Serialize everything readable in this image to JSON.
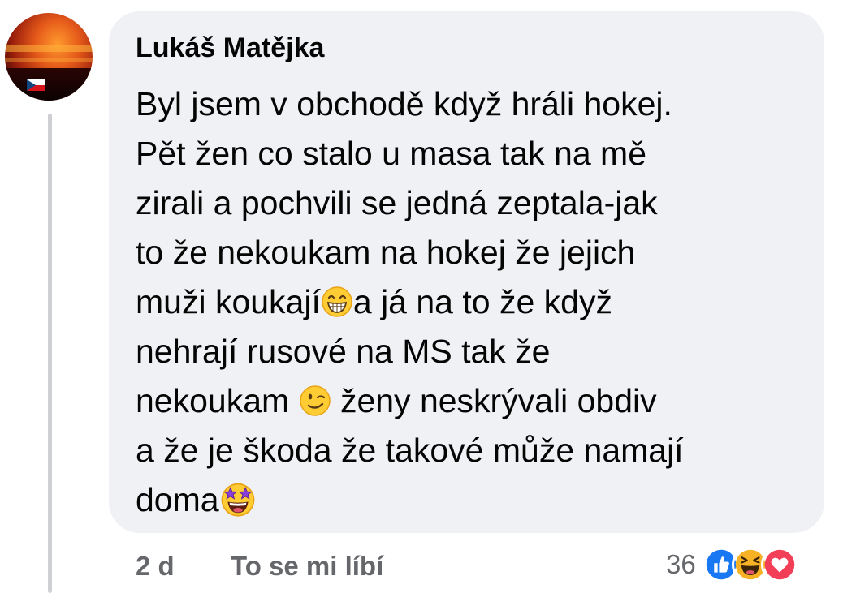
{
  "comment": {
    "author": "Lukáš Matějka",
    "lines": [
      {
        "before": "Byl jsem v obchodě když hráli hokej.",
        "emoji": "",
        "after": ""
      },
      {
        "before": "Pět žen co stalo u masa tak na mě",
        "emoji": "",
        "after": ""
      },
      {
        "before": "zirali  a pochvili se jedná zeptala-jak",
        "emoji": "",
        "after": ""
      },
      {
        "before": "to že nekoukam na hokej že jejich",
        "emoji": "",
        "after": ""
      },
      {
        "before": "muži koukají",
        "emoji": "grinning-face-with-smiling-eyes-icon",
        "after": "a já na to že když"
      },
      {
        "before": "nehrají rusové na MS tak že",
        "emoji": "",
        "after": ""
      },
      {
        "before": "nekoukam ",
        "emoji": "winking-face-icon",
        "after": " ženy neskrývali obdiv"
      },
      {
        "before": "a že je škoda že takové může namají",
        "emoji": "",
        "after": ""
      },
      {
        "before": "doma",
        "emoji": "star-struck-face-icon",
        "after": ""
      }
    ]
  },
  "footer": {
    "time": "2 d",
    "like_label": "To se mi líbí",
    "reaction_count": "36",
    "reactions": [
      "like-reaction-icon",
      "haha-reaction-icon",
      "love-reaction-icon"
    ]
  },
  "colors": {
    "bubble": "#eff1f4",
    "meta_text": "#65676b",
    "like": "#1877f2",
    "love": "#f33e58",
    "haha": "#f7b125"
  }
}
